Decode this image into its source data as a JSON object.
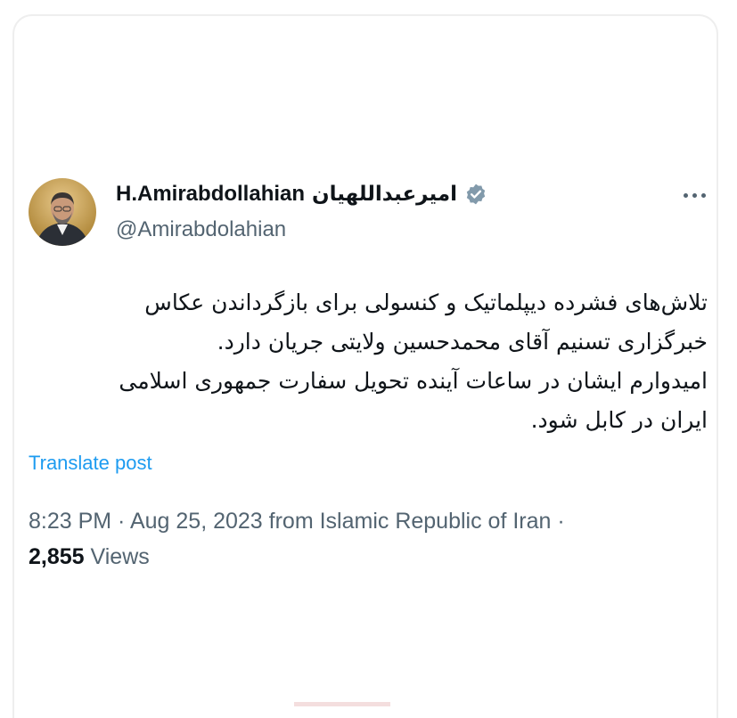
{
  "author": {
    "display_name_en": "H.Amirabdollahian",
    "display_name_fa": "امیرعبداللهیان",
    "handle": "@Amirabdolahian",
    "verified": true
  },
  "icons": {
    "verified": "verified-badge-icon",
    "more": "more-horizontal-icon"
  },
  "tweet": {
    "lines": [
      "تلاش‌های فشرده دیپلماتیک و کنسولی برای بازگرداندن عکاس",
      "خبرگزاری تسنیم آقای محمدحسین ولایتی جریان دارد.",
      "امیدوارم ایشان در ساعات آینده تحویل سفارت جمهوری اسلامی",
      "ایران در کابل شود."
    ],
    "translate_label": "Translate post",
    "time": "8:23 PM",
    "sep1": " · ",
    "date": "Aug 25, 2023",
    "source": " from Islamic Republic of Iran",
    "sep2": " · ",
    "views_count": "2,855",
    "views_label": " Views"
  },
  "colors": {
    "link": "#1d9bf0",
    "secondary_text": "#536471",
    "verified_badge": "#829aab"
  }
}
